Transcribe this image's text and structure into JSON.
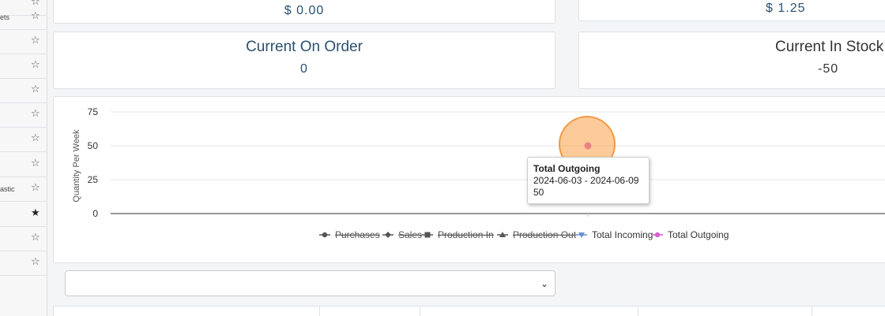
{
  "sidebar": {
    "items": [
      {
        "label": "",
        "starred": false
      },
      {
        "label": "ets",
        "starred": false
      },
      {
        "label": "",
        "starred": false
      },
      {
        "label": "",
        "starred": false
      },
      {
        "label": "",
        "starred": false
      },
      {
        "label": "",
        "starred": false
      },
      {
        "label": "",
        "starred": false
      },
      {
        "label": "",
        "starred": false
      },
      {
        "label": "astic",
        "starred": false
      },
      {
        "label": "",
        "starred": true
      },
      {
        "label": "",
        "starred": false
      },
      {
        "label": "",
        "starred": false
      }
    ],
    "star_empty": "☆",
    "star_filled": "★"
  },
  "cards": {
    "top_left_value": "$ 0.00",
    "top_right_value": "$ 1.25",
    "on_order_title": "Current On Order",
    "on_order_value": "0",
    "in_stock_title": "Current In Stock",
    "in_stock_value": "-50"
  },
  "chart_data": {
    "type": "line",
    "ylabel": "Quantity Per Week",
    "yticks": [
      0,
      25,
      50,
      75
    ],
    "ylim": [
      0,
      75
    ],
    "x": [
      "2024-06-03 - 2024-06-09"
    ],
    "series": [
      {
        "name": "Purchases",
        "hidden": true,
        "marker": "circle",
        "color": "#555555",
        "values": [
          0
        ]
      },
      {
        "name": "Sales",
        "hidden": true,
        "marker": "diamond",
        "color": "#555555",
        "values": [
          0
        ]
      },
      {
        "name": "Production In",
        "hidden": true,
        "marker": "square",
        "color": "#555555",
        "values": [
          0
        ]
      },
      {
        "name": "Production Out",
        "hidden": true,
        "marker": "triangle",
        "color": "#555555",
        "values": [
          0
        ]
      },
      {
        "name": "Total Incoming",
        "hidden": false,
        "marker": "triangle-down",
        "color": "#6a8fd0",
        "values": [
          0
        ]
      },
      {
        "name": "Total Outgoing",
        "hidden": false,
        "marker": "circle",
        "color": "#d45fd0",
        "values": [
          50
        ]
      }
    ],
    "grid": true,
    "legend": "bottom-center"
  },
  "tooltip": {
    "title": "Total Outgoing",
    "range": "2024-06-03 - 2024-06-09",
    "value": "50"
  },
  "select": {
    "value": "",
    "chevron": "⌄"
  }
}
